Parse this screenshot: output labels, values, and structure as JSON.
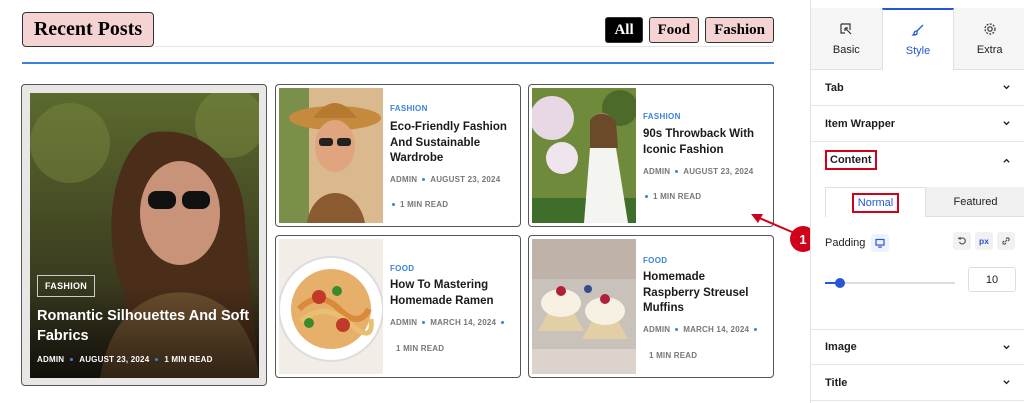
{
  "preview": {
    "heading": "Recent Posts",
    "filters": [
      "All",
      "Food",
      "Fashion"
    ],
    "active_filter": "All",
    "featured": {
      "category": "FASHION",
      "title": "Romantic Silhouettes And Soft Fabrics",
      "author": "ADMIN",
      "date": "AUGUST 23, 2024",
      "read_time": "1 MIN READ"
    },
    "posts": [
      {
        "category": "FASHION",
        "title": "Eco-Friendly Fashion And Sustainable Wardrobe",
        "author": "ADMIN",
        "date": "AUGUST 23, 2024",
        "read_time": "1 MIN READ"
      },
      {
        "category": "FASHION",
        "title": "90s Throwback With Iconic Fashion",
        "author": "ADMIN",
        "date": "AUGUST 23, 2024",
        "read_time": "1 MIN READ"
      },
      {
        "category": "FOOD",
        "title": "How To Mastering Homemade Ramen",
        "author": "ADMIN",
        "date": "MARCH 14, 2024",
        "read_time": "1 MIN READ"
      },
      {
        "category": "FOOD",
        "title": "Homemade Raspberry Streusel Muffins",
        "author": "ADMIN",
        "date": "MARCH 14, 2024",
        "read_time": "1 MIN READ"
      }
    ],
    "marker": "1"
  },
  "panel": {
    "tabs": [
      {
        "label": "Basic",
        "icon": "cursor-icon"
      },
      {
        "label": "Style",
        "icon": "brush-icon"
      },
      {
        "label": "Extra",
        "icon": "gear-icon"
      }
    ],
    "active_tab": "Style",
    "sections": [
      "Tab",
      "Item Wrapper",
      "Content",
      "Image",
      "Title"
    ],
    "content": {
      "subtabs": [
        "Normal",
        "Featured"
      ],
      "active_subtab": "Normal",
      "padding_label": "Padding",
      "unit": "px",
      "padding_value": "10"
    }
  },
  "colors": {
    "accent": "#2457d6",
    "link": "#3b82e0",
    "highlight": "#d0021b",
    "filter_bg": "#f6d3d3"
  }
}
